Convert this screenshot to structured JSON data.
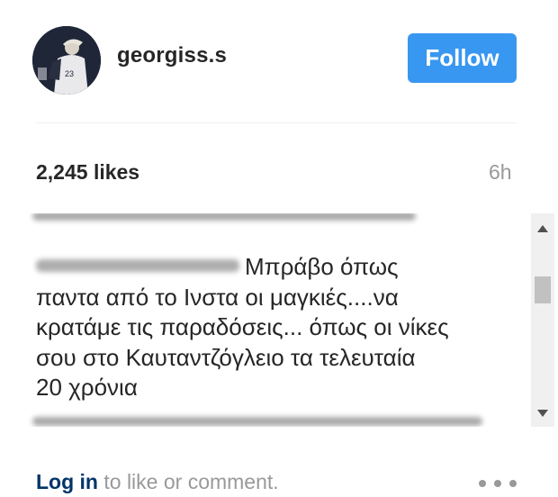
{
  "header": {
    "username": "georgiss.s",
    "follow_label": "Follow",
    "avatar_icon": "profile-photo"
  },
  "stats": {
    "likes": "2,245 likes",
    "time_ago": "6h"
  },
  "comment": {
    "text_line_1": "Μπράβο όπως",
    "text_line_2": "παντα από το Ινστα οι μαγκιές....να",
    "text_line_3": "κρατάμε τις παραδόσεις... όπως οι νίκες",
    "text_line_4": "σου στο Καυταντζόγλειο τα τελευταία",
    "text_line_5": "20 χρόνια"
  },
  "footer": {
    "login_label": "Log in",
    "rest_label": " to like or comment."
  },
  "colors": {
    "accent": "#3897f0",
    "text": "#262626",
    "muted": "#999999",
    "link": "#003569"
  }
}
